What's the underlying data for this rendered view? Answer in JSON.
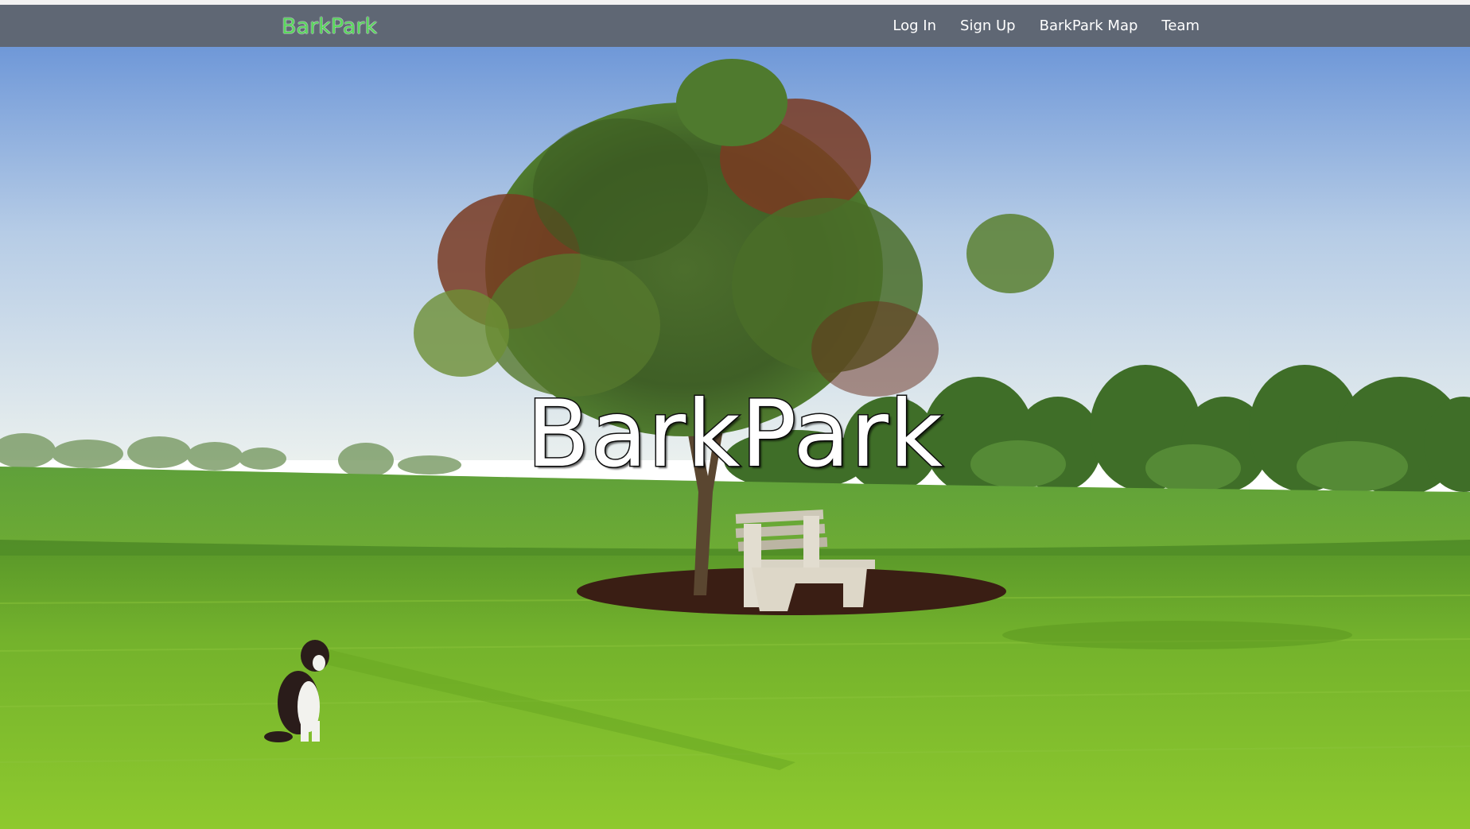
{
  "navbar": {
    "brand": "BarkPark",
    "links": [
      {
        "label": "Log In"
      },
      {
        "label": "Sign Up"
      },
      {
        "label": "BarkPark Map"
      },
      {
        "label": "Team"
      }
    ]
  },
  "hero": {
    "title": "BarkPark"
  },
  "colors": {
    "navbar_bg": "#5f6774",
    "brand": "#59d95c",
    "nav_text": "#ffffff",
    "title_text": "#ffffff"
  }
}
